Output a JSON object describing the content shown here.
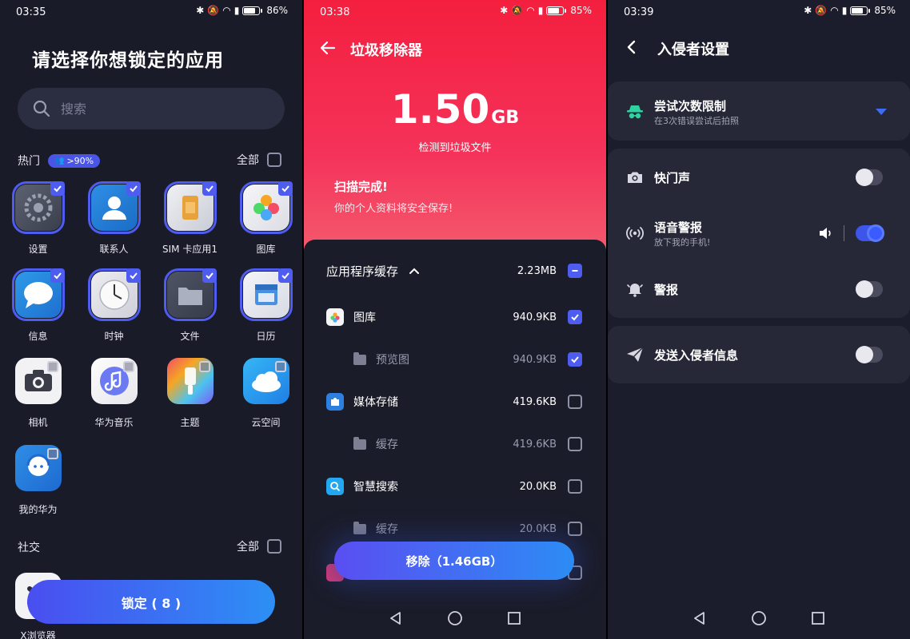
{
  "panel1": {
    "status": {
      "time": "03:35",
      "battery": "86%",
      "battery_level": 0.86
    },
    "title": "请选择你想锁定的应用",
    "search": {
      "placeholder": "搜索"
    },
    "hot": {
      "label": "热门",
      "badge": ">90%",
      "all_label": "全部"
    },
    "apps": [
      {
        "name": "设置",
        "icon": "settings-gear-icon",
        "selected": true
      },
      {
        "name": "联系人",
        "icon": "contacts-icon",
        "selected": true
      },
      {
        "name": "SIM 卡应用1",
        "icon": "sim-card-icon",
        "selected": true
      },
      {
        "name": "图库",
        "icon": "gallery-icon",
        "selected": true
      },
      {
        "name": "信息",
        "icon": "messages-icon",
        "selected": true
      },
      {
        "name": "时钟",
        "icon": "clock-icon",
        "selected": true
      },
      {
        "name": "文件",
        "icon": "files-folder-icon",
        "selected": true
      },
      {
        "name": "日历",
        "icon": "calendar-icon",
        "selected": true
      },
      {
        "name": "相机",
        "icon": "camera-icon",
        "selected": false
      },
      {
        "name": "华为音乐",
        "icon": "music-note-icon",
        "selected": false
      },
      {
        "name": "主题",
        "icon": "theme-brush-icon",
        "selected": false
      },
      {
        "name": "云空间",
        "icon": "cloud-icon",
        "selected": false
      },
      {
        "name": "我的华为",
        "icon": "support-headset-icon",
        "selected": false
      }
    ],
    "social": {
      "label": "社交",
      "all_label": "全部"
    },
    "social_apps": [
      {
        "name": "X浏览器",
        "icon": "browser-icon"
      }
    ],
    "lock_button": "锁定 ( 8 )"
  },
  "panel2": {
    "status": {
      "time": "03:38",
      "battery": "85%",
      "battery_level": 0.85
    },
    "title": "垃圾移除器",
    "size_value": "1.50",
    "size_unit": "GB",
    "detected": "检测到垃圾文件",
    "scan_done": "扫描完成!",
    "safe_text": "你的个人资料将安全保存!",
    "cache_section": {
      "label": "应用程序缓存",
      "size": "2.23MB"
    },
    "rows": [
      {
        "label": "图库",
        "size": "940.9KB",
        "checked": true,
        "sub": false,
        "icon": "gallery-icon"
      },
      {
        "label": "预览图",
        "size": "940.9KB",
        "checked": true,
        "sub": true,
        "icon": "folder-icon"
      },
      {
        "label": "媒体存储",
        "size": "419.6KB",
        "checked": false,
        "sub": false,
        "icon": "puzzle-icon"
      },
      {
        "label": "缓存",
        "size": "419.6KB",
        "checked": false,
        "sub": true,
        "icon": "folder-icon"
      },
      {
        "label": "智慧搜索",
        "size": "20.0KB",
        "checked": false,
        "sub": false,
        "icon": "search-icon"
      },
      {
        "label": "缓存",
        "size": "20.0KB",
        "checked": false,
        "sub": true,
        "icon": "folder-icon"
      }
    ],
    "remove_button": "移除（1.46GB）"
  },
  "panel3": {
    "status": {
      "time": "03:39",
      "battery": "85%",
      "battery_level": 0.85
    },
    "title": "入侵者设置",
    "attempts": {
      "label": "尝试次数限制",
      "sub": "在3次错误尝试后拍照"
    },
    "shutter": {
      "label": "快门声",
      "on": false
    },
    "voice": {
      "label": "语音警报",
      "sub": "放下我的手机!",
      "on": true
    },
    "alarm": {
      "label": "警报",
      "on": false
    },
    "send": {
      "label": "发送入侵者信息",
      "on": false
    }
  },
  "colors": {
    "accent": "#4e5cf0",
    "junk_red": "#f41f3e",
    "bg": "#1a1b29",
    "spy_green": "#2fd3a0"
  }
}
